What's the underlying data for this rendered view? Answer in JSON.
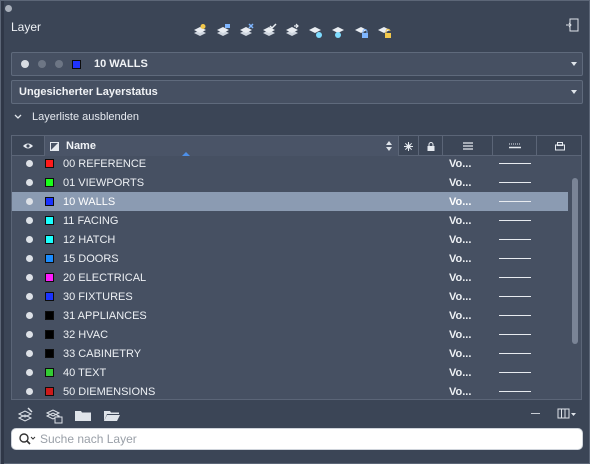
{
  "window": {
    "title": "Layer"
  },
  "toolbar": {
    "buttons": [
      {
        "name": "new-layer-icon"
      },
      {
        "name": "new-layer-vp-frozen-icon"
      },
      {
        "name": "delete-layer-icon"
      },
      {
        "name": "set-current-icon"
      },
      {
        "name": "layer-states-icon"
      },
      {
        "name": "isolate-icon"
      },
      {
        "name": "unisolate-icon"
      },
      {
        "name": "lock-icon"
      },
      {
        "name": "unlock-icon"
      }
    ]
  },
  "current_layer": {
    "name": "10 WALLS",
    "color": "#1f33ff"
  },
  "layer_status": {
    "label": "Ungesicherter Layerstatus"
  },
  "collapse": {
    "label": "Layerliste ausblenden"
  },
  "table": {
    "headers": {
      "name": "Name"
    },
    "rows": [
      {
        "name": "00 REFERENCE",
        "color": "#ff1a1a",
        "linetype": "Vo..."
      },
      {
        "name": "01 VIEWPORTS",
        "color": "#1aff1a",
        "linetype": "Vo..."
      },
      {
        "name": "10 WALLS",
        "color": "#1a33ff",
        "linetype": "Vo...",
        "selected": true
      },
      {
        "name": "11 FACING",
        "color": "#1affff",
        "linetype": "Vo..."
      },
      {
        "name": "12 HATCH",
        "color": "#1affff",
        "linetype": "Vo..."
      },
      {
        "name": "15 DOORS",
        "color": "#1a8cff",
        "linetype": "Vo..."
      },
      {
        "name": "20 ELECTRICAL",
        "color": "#ff1aff",
        "linetype": "Vo..."
      },
      {
        "name": "30 FIXTURES",
        "color": "#1a33ff",
        "linetype": "Vo..."
      },
      {
        "name": "31 APPLIANCES",
        "color": "#000000",
        "linetype": "Vo..."
      },
      {
        "name": "32 HVAC",
        "color": "#000000",
        "linetype": "Vo..."
      },
      {
        "name": "33 CABINETRY",
        "color": "#000000",
        "linetype": "Vo..."
      },
      {
        "name": "40 TEXT",
        "color": "#33cc33",
        "linetype": "Vo..."
      },
      {
        "name": "50 DIEMENSIONS",
        "color": "#cc1a1a",
        "linetype": "Vo..."
      }
    ]
  },
  "search": {
    "placeholder": "Suche nach Layer",
    "value": ""
  }
}
